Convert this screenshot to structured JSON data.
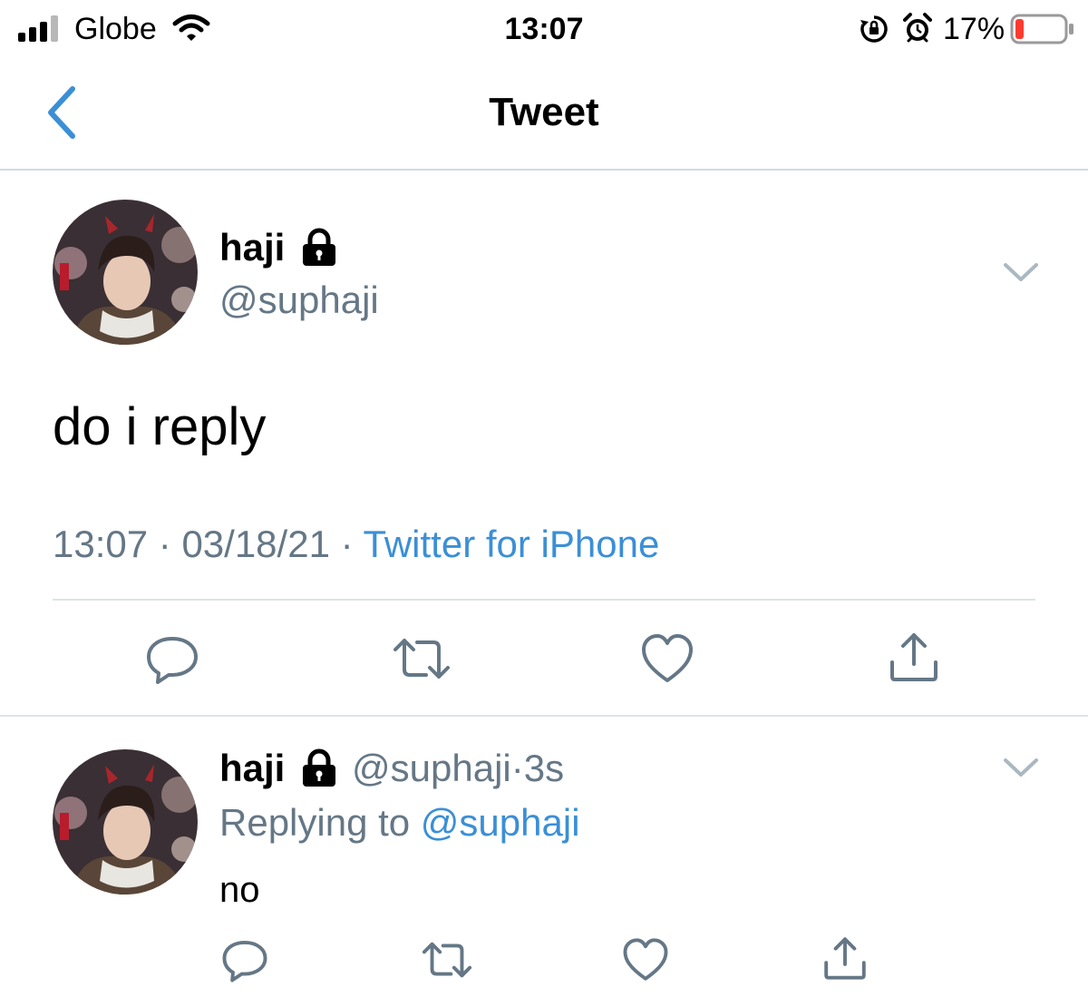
{
  "status": {
    "carrier": "Globe",
    "time": "13:07",
    "battery": "17%",
    "battery_level": 0.17,
    "battery_color": "#ff3b30"
  },
  "nav": {
    "title": "Tweet",
    "back_icon": "chevron-left-icon",
    "accent": "#3b8fd6"
  },
  "tweet": {
    "name": "haji",
    "handle": "@suphaji",
    "text": "do i reply",
    "time": "13:07",
    "separator": "·",
    "date": "03/18/21",
    "source": "Twitter for iPhone",
    "actions": [
      "reply-icon",
      "retweet-icon",
      "like-icon",
      "share-icon"
    ]
  },
  "reply": {
    "name": "haji",
    "handle": "@suphaji",
    "separator": "·",
    "age": "3s",
    "replying_prefix": "Replying to",
    "replying_handle": "@suphaji",
    "text": "no",
    "actions": [
      "reply-icon",
      "retweet-icon",
      "like-icon",
      "share-icon"
    ]
  }
}
